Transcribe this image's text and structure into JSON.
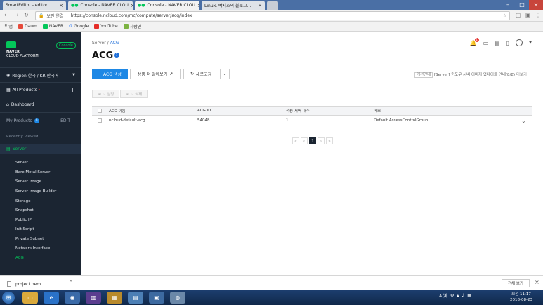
{
  "browser": {
    "tabs": [
      {
        "title": "SmartEditor - editor"
      },
      {
        "title": "Console - NAVER CLOU"
      },
      {
        "title": "Console - NAVER CLOU"
      },
      {
        "title": "Linux. 박지호의 블로그..."
      }
    ],
    "security_label": "보안 연결",
    "url": "https://console.ncloud.com/mc/compute/server/acg/index",
    "bookmarks": [
      "앱",
      "Daum",
      "NAVER",
      "Google",
      "YouTube",
      "사람인"
    ]
  },
  "sidebar": {
    "logo_line1": "NAVER",
    "logo_line2": "CLOUD PLATFORM",
    "console_badge": "Console",
    "region": "Region 한국 / KR 한국어",
    "all_products": "All Products",
    "dashboard": "Dashboard",
    "my_products": "My Products",
    "my_products_count": "0",
    "edit": "EDIT",
    "recently_viewed": "Recently Viewed",
    "server": "Server",
    "sub_items": [
      "Server",
      "Bare Metal Server",
      "Server Image",
      "Server Image Builder",
      "Storage",
      "Snapshot",
      "Public IP",
      "Init Script",
      "Private Subnet",
      "Network Interface",
      "ACG"
    ],
    "active_sub": "ACG"
  },
  "header": {
    "breadcrumb_root": "Server",
    "breadcrumb_sep": "/",
    "breadcrumb_current": "ACG",
    "notif_count": "1"
  },
  "main": {
    "title": "ACG",
    "info_icon": "?",
    "create_button": "+ ACG 생성",
    "learn_more_button": "상품 더 알아보기",
    "refresh_button": "새로고침",
    "notice_tag": "개선안내",
    "notice_text": "[Server] 윈도우 서버 이미지 업데이트 안내(8/8)",
    "notice_more": "더보기",
    "acg_settings_button": "ACG 설정",
    "acg_delete_button": "ACG 삭제",
    "table": {
      "headers": [
        "ACG 이름",
        "ACG ID",
        "적용 서버 대수",
        "메모"
      ],
      "rows": [
        {
          "name": "ncloud-default-acg",
          "id": "54048",
          "servers": "1",
          "memo": "Default AccessControlGroup"
        }
      ]
    },
    "pagination": {
      "current": "1"
    }
  },
  "download_bar": {
    "file": "project.pem",
    "show_all": "전체 보기"
  },
  "taskbar": {
    "time": "오전 11:17",
    "date": "2018-08-23",
    "ime": "A 漢"
  }
}
